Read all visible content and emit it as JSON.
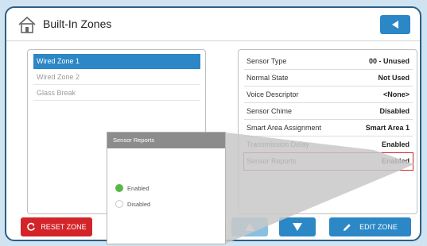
{
  "header": {
    "title": "Built-In Zones"
  },
  "zones": [
    {
      "label": "Wired Zone 1",
      "selected": true
    },
    {
      "label": "Wired Zone 2",
      "selected": false
    },
    {
      "label": "Glass Break",
      "selected": false
    }
  ],
  "properties": [
    {
      "label": "Sensor Type",
      "value": "00 - Unused"
    },
    {
      "label": "Normal State",
      "value": "Not Used"
    },
    {
      "label": "Voice Descriptor",
      "value": "<None>"
    },
    {
      "label": "Sensor Chime",
      "value": "Disabled"
    },
    {
      "label": "Smart Area Assignment",
      "value": "Smart Area 1"
    },
    {
      "label": "Transmission Delay",
      "value": "Enabled"
    },
    {
      "label": "Sensor Reports",
      "value": "Enabled",
      "highlighted": true
    }
  ],
  "buttons": {
    "reset_label": "RESET ZONE",
    "edit_label": "EDIT ZONE"
  },
  "popup": {
    "title": "Sensor Reports",
    "options": [
      {
        "label": "Enabled",
        "selected": true
      },
      {
        "label": "Disabled",
        "selected": false
      }
    ]
  },
  "colors": {
    "accent": "#2b87c6",
    "danger": "#d3242a",
    "frame": "#2c5f86",
    "radio_on": "#57b845"
  },
  "icons": {
    "home": "home-icon",
    "back": "back-triangle-icon",
    "reset": "refresh-icon",
    "up": "arrow-up-icon",
    "down": "arrow-down-icon",
    "edit": "pencil-icon"
  }
}
